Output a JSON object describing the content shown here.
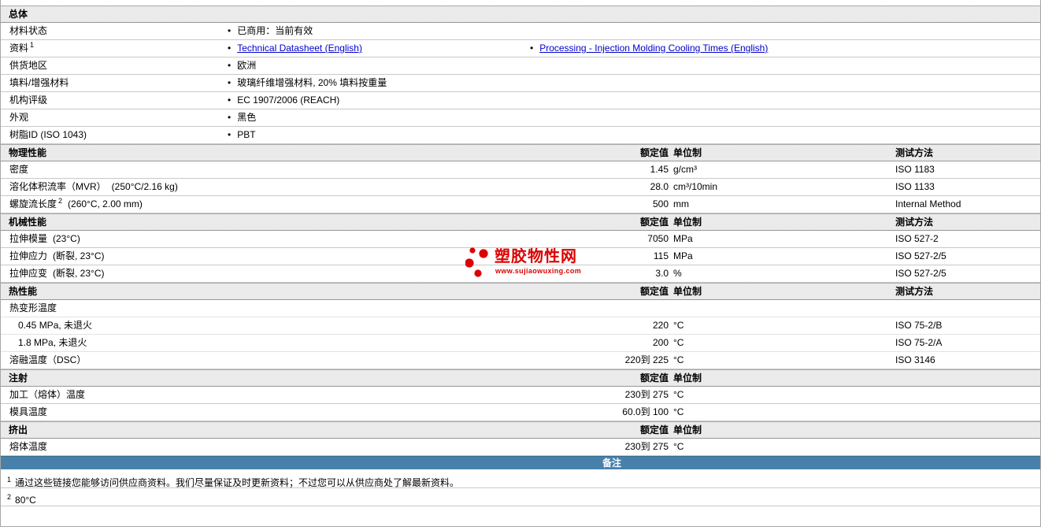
{
  "colors": {
    "accent_blue": "#4781ab",
    "link_blue": "#0000cc",
    "watermark_red": "#dd0000",
    "section_header_bg": "#e6e6e6"
  },
  "watermark": {
    "name": "塑胶物性网",
    "url": "www.sujiaowuxing.com"
  },
  "column_headers": {
    "nominal": "额定值",
    "unit": "单位制",
    "method": "测试方法"
  },
  "general": {
    "title": "总体",
    "rows": [
      {
        "label": "材料状态",
        "items": [
          {
            "type": "text",
            "text": "已商用：当前有效"
          }
        ]
      },
      {
        "label": "资料",
        "sup": "1",
        "items": [
          {
            "type": "link",
            "text": "Technical Datasheet (English)"
          },
          {
            "type": "link",
            "text": "Processing - Injection Molding Cooling Times (English)",
            "col": 2
          }
        ]
      },
      {
        "label": "供货地区",
        "items": [
          {
            "type": "text",
            "text": "欧洲"
          }
        ]
      },
      {
        "label": "填料/增强材料",
        "items": [
          {
            "type": "text",
            "text": "玻璃纤维增强材料, 20% 填料按重量"
          }
        ]
      },
      {
        "label": "机构评级",
        "items": [
          {
            "type": "text",
            "text": "EC 1907/2006 (REACH)"
          }
        ]
      },
      {
        "label": "外观",
        "items": [
          {
            "type": "text",
            "text": "黑色"
          }
        ]
      },
      {
        "label": "树脂ID (ISO 1043)",
        "items": [
          {
            "type": "text",
            "text": "PBT"
          }
        ]
      }
    ]
  },
  "sections": [
    {
      "title": "物理性能",
      "show_method_header": true,
      "rows": [
        {
          "label": "密度",
          "value": "1.45",
          "unit": "g/cm³",
          "method": "ISO 1183"
        },
        {
          "label": "溶化体积流率（MVR）",
          "cond": "(250°C/2.16 kg)",
          "value": "28.0",
          "unit": "cm³/10min",
          "method": "ISO 1133"
        },
        {
          "label": "螺旋流长度",
          "sup": "2",
          "cond": "(260°C, 2.00 mm)",
          "value": "500",
          "unit": "mm",
          "method": "Internal Method"
        }
      ]
    },
    {
      "title": "机械性能",
      "show_method_header": true,
      "rows": [
        {
          "label": "拉伸模量",
          "cond": "(23°C)",
          "value": "7050",
          "unit": "MPa",
          "method": "ISO 527-2"
        },
        {
          "label": "拉伸应力",
          "cond": "(断裂, 23°C)",
          "value": "115",
          "unit": "MPa",
          "method": "ISO 527-2/5"
        },
        {
          "label": "拉伸应变",
          "cond": "(断裂, 23°C)",
          "value": "3.0",
          "unit": "%",
          "method": "ISO 527-2/5"
        }
      ]
    },
    {
      "title": "热性能",
      "show_method_header": true,
      "rows": [
        {
          "label": "热变形温度",
          "group": true,
          "light": true
        },
        {
          "label": "0.45 MPa, 未退火",
          "indent": true,
          "light": true,
          "value": "220",
          "unit": "°C",
          "method": "ISO 75-2/B"
        },
        {
          "label": "1.8 MPa, 未退火",
          "indent": true,
          "light": true,
          "value": "200",
          "unit": "°C",
          "method": "ISO 75-2/A"
        },
        {
          "label": "溶融温度（DSC）",
          "value": "220到 225",
          "unit": "°C",
          "method": "ISO 3146"
        }
      ]
    },
    {
      "title": "注射",
      "show_method_header": false,
      "rows": [
        {
          "label": "加工（熔体）温度",
          "value": "230到 275",
          "unit": "°C"
        },
        {
          "label": "模具温度",
          "value": "60.0到 100",
          "unit": "°C"
        }
      ]
    },
    {
      "title": "挤出",
      "show_method_header": false,
      "rows": [
        {
          "label": "熔体温度",
          "value": "230到 275",
          "unit": "°C"
        }
      ]
    }
  ],
  "notes": {
    "title": "备注",
    "footnotes": [
      {
        "sup": "1",
        "text": "通过这些链接您能够访问供应商资料。我们尽量保证及时更新资料；不过您可以从供应商处了解最新资料。"
      },
      {
        "sup": "2",
        "text": "80°C"
      }
    ]
  }
}
